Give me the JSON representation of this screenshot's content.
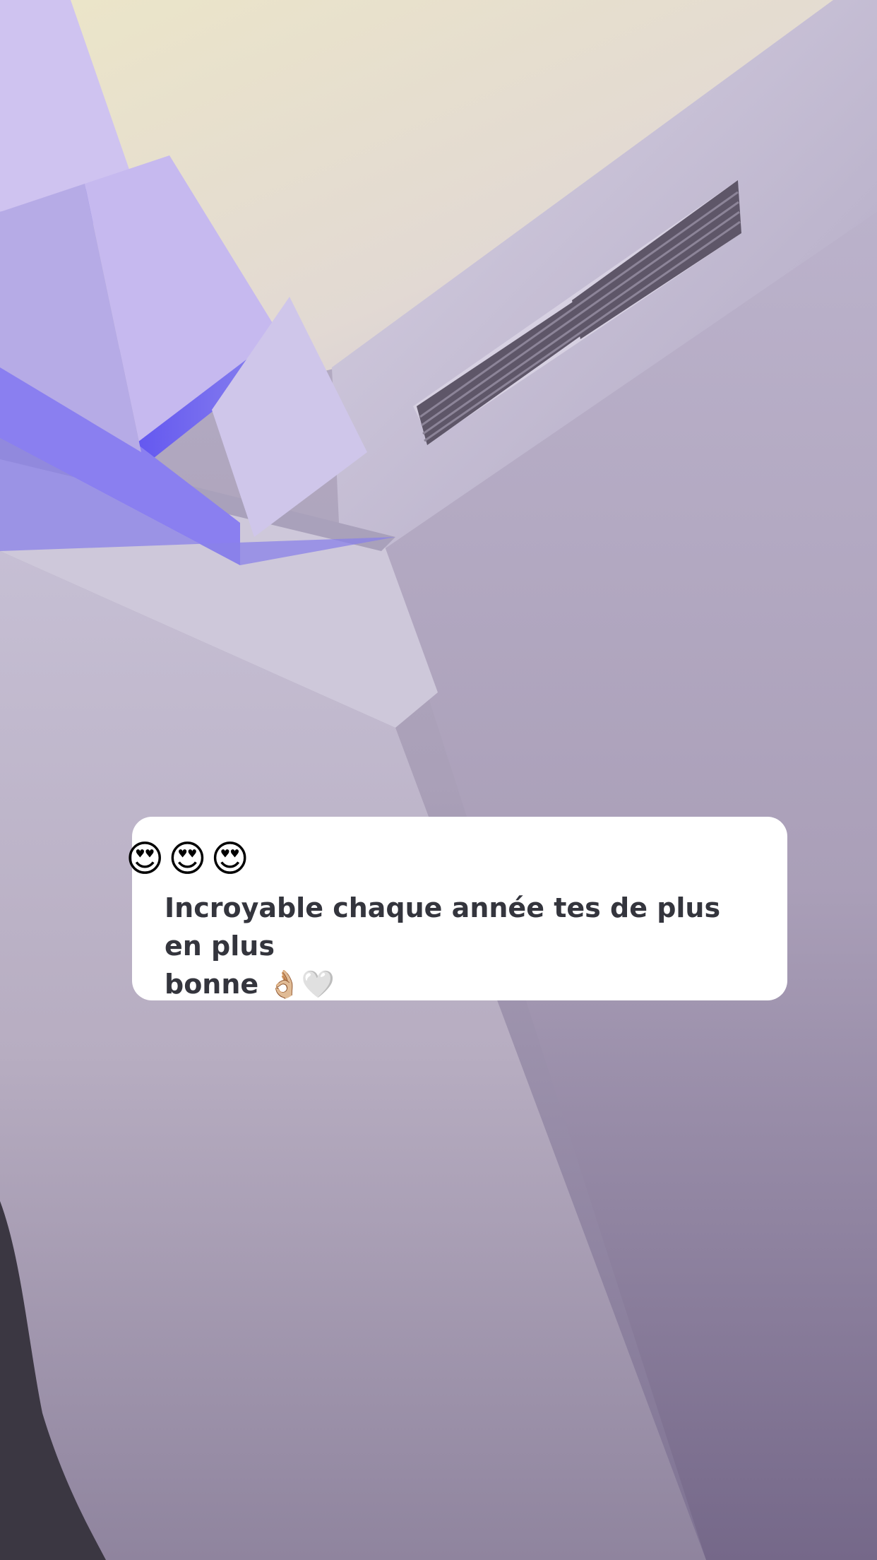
{
  "story": {
    "background": "photo-of-room-ceiling-with-purple-light",
    "colors": {
      "ceiling": "#e4dccb",
      "wall": "#aba0b8",
      "purple_light": "#6a5bf2",
      "card_bg": "#ffffff",
      "text": "#34353d"
    }
  },
  "reply_sticker": {
    "reactions": [
      "😍",
      "😍",
      "😍"
    ],
    "text_line1": "Incroyable chaque année tes de plus en plus",
    "text_line2": "bonne 👌🏼🤍"
  }
}
